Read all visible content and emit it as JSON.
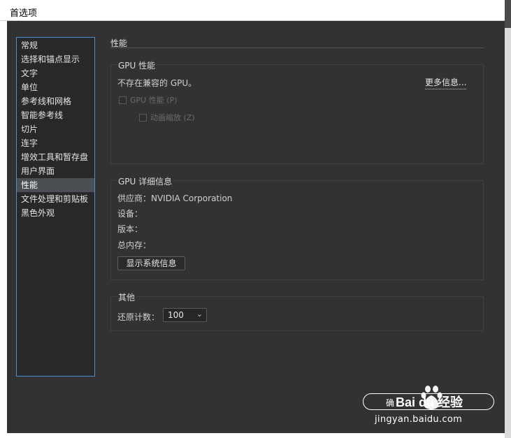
{
  "window": {
    "title": "首选项"
  },
  "sidebar": {
    "items": [
      {
        "label": "常规",
        "active": false
      },
      {
        "label": "选择和锚点显示",
        "active": false
      },
      {
        "label": "文字",
        "active": false
      },
      {
        "label": "单位",
        "active": false
      },
      {
        "label": "参考线和网格",
        "active": false
      },
      {
        "label": "智能参考线",
        "active": false
      },
      {
        "label": "切片",
        "active": false
      },
      {
        "label": "连字",
        "active": false
      },
      {
        "label": "增效工具和暂存盘",
        "active": false
      },
      {
        "label": "用户界面",
        "active": false
      },
      {
        "label": "性能",
        "active": true
      },
      {
        "label": "文件处理和剪贴板",
        "active": false
      },
      {
        "label": "黑色外观",
        "active": false
      }
    ]
  },
  "main": {
    "section_title": "性能",
    "gpu": {
      "legend": "GPU 性能",
      "message": "不存在兼容的 GPU。",
      "more_info": "更多信息...",
      "gpu_perf_checkbox": "GPU 性能 (P)",
      "anim_zoom_checkbox": "动画缩放 (Z)"
    },
    "details": {
      "legend": "GPU 详细信息",
      "vendor": "供应商：NVIDIA Corporation",
      "device": "设备：",
      "version": "版本：",
      "memory": "总内存：",
      "show_sysinfo_button": "显示系统信息"
    },
    "other": {
      "legend": "其他",
      "undo_label": "还原计数：",
      "undo_value": "100"
    }
  },
  "footer": {
    "ok_label": "确"
  },
  "watermark": {
    "brand": "Bai du 经验",
    "url": "jingyan.baidu.com"
  },
  "colors": {
    "dialog_bg": "#323232",
    "sidebar_bg": "#282828",
    "sidebar_border": "#4a8ed8",
    "active_item_bg": "#4b4e53"
  }
}
